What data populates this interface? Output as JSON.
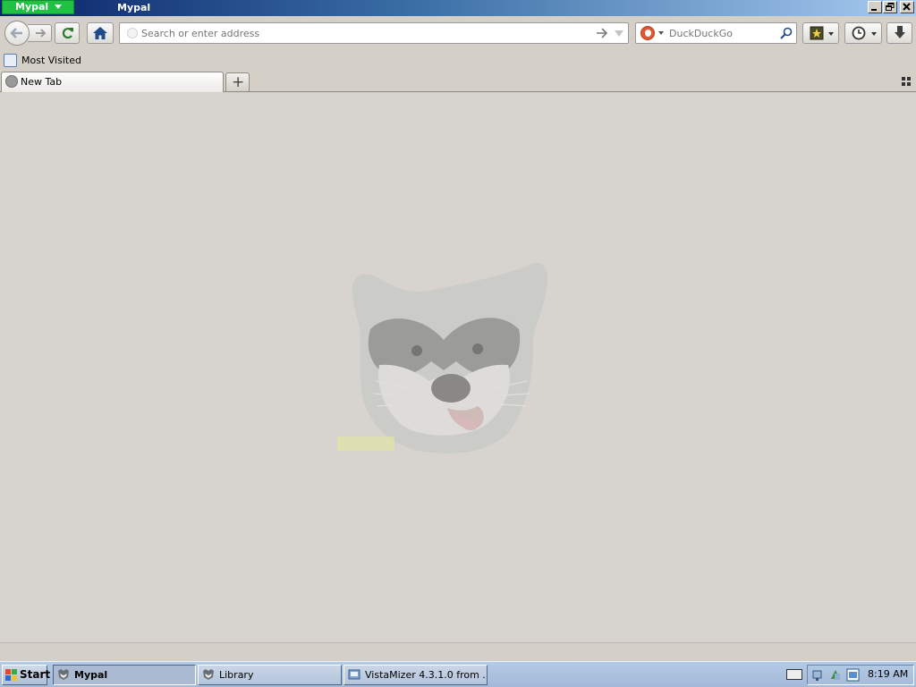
{
  "window": {
    "app_menu_label": "Mypal",
    "title": "Mypal"
  },
  "navbar": {
    "url_placeholder": "Search or enter address",
    "search_placeholder": "DuckDuckGo"
  },
  "bookmarks_bar": {
    "items": [
      {
        "label": "Most Visited"
      }
    ]
  },
  "tabs": [
    {
      "label": "New Tab",
      "active": true
    }
  ],
  "new_tab_button_label": "+",
  "taskbar": {
    "start_label": "Start",
    "tasks": [
      {
        "label": "Mypal",
        "active": true
      },
      {
        "label": "Library",
        "active": false
      },
      {
        "label": "VistaMizer 4.3.1.0 from ...",
        "active": false
      }
    ],
    "clock": "8:19 AM"
  },
  "icons": {
    "back": "back-arrow-icon",
    "forward": "forward-arrow-icon",
    "reload": "reload-icon",
    "home": "home-icon",
    "go": "go-arrow-icon",
    "search_engine": "duckduckgo-icon",
    "search": "magnifier-icon",
    "bookmarks": "bookmark-star-icon",
    "history": "clock-icon",
    "downloads": "download-arrow-icon",
    "tab_grid": "grid-icon",
    "mascot": "raccoon-mascot"
  },
  "colors": {
    "app_menu": "#1fc243",
    "titlebar_start": "#0a246a",
    "titlebar_end": "#a6caf0",
    "taskbar": "#b4cbe6",
    "content_bg": "#d7d3ce"
  }
}
